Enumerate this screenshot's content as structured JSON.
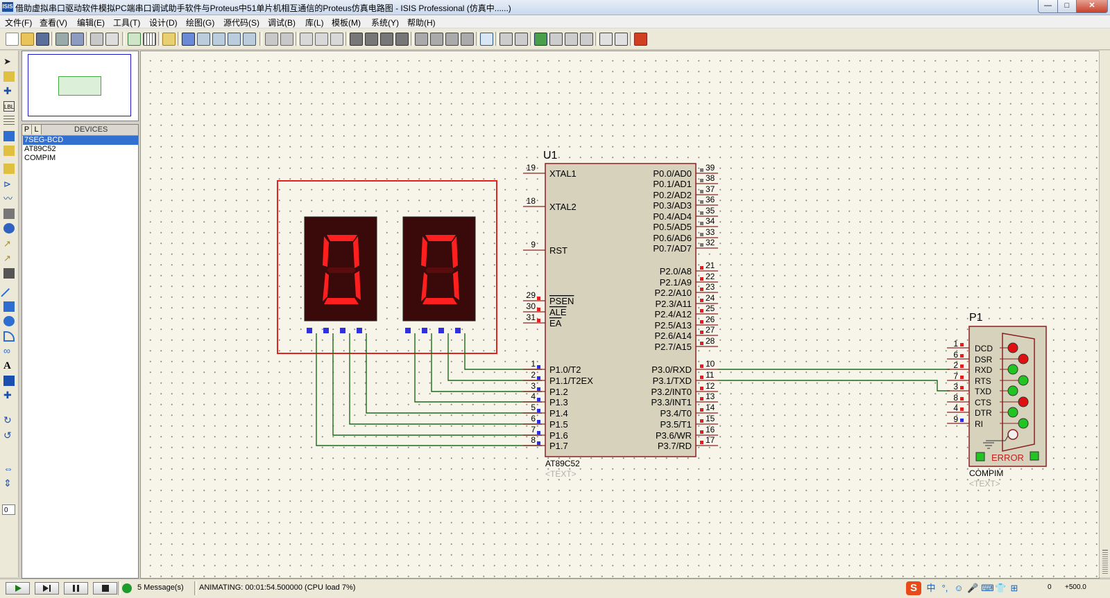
{
  "window": {
    "title": "借助虚拟串口驱动软件模拟PC端串口调试助手软件与Proteus中51单片机相互通信的Proteus仿真电路图 - ISIS Professional (仿真中......)",
    "app_icon": "ISIS",
    "min_glyph": "—",
    "max_glyph": "□",
    "close_glyph": "✕"
  },
  "menu": [
    "文件(F)",
    "查看(V)",
    "编辑(E)",
    "工具(T)",
    "设计(D)",
    "绘图(G)",
    "源代码(S)",
    "调试(B)",
    "库(L)",
    "模板(M)",
    "系统(Y)",
    "帮助(H)"
  ],
  "devices": {
    "tab_p": "P",
    "tab_l": "L",
    "header": "DEVICES",
    "items": [
      "7SEG-BCD",
      "AT89C52",
      "COMPIM"
    ],
    "selected_index": 0
  },
  "zoom_field": "0",
  "schematic": {
    "digits": [
      "0",
      "0"
    ],
    "mcu": {
      "ref": "U1",
      "part": "AT89C52",
      "text": "<TEXT>",
      "left_pins": [
        {
          "num": "19",
          "name": "XTAL1"
        },
        {
          "num": "18",
          "name": "XTAL2"
        },
        {
          "num": "9",
          "name": "RST"
        },
        {
          "num": "29",
          "name": "PSEN"
        },
        {
          "num": "30",
          "name": "ALE"
        },
        {
          "num": "31",
          "name": "EA"
        },
        {
          "num": "1",
          "name": "P1.0/T2"
        },
        {
          "num": "2",
          "name": "P1.1/T2EX"
        },
        {
          "num": "3",
          "name": "P1.2"
        },
        {
          "num": "4",
          "name": "P1.3"
        },
        {
          "num": "5",
          "name": "P1.4"
        },
        {
          "num": "6",
          "name": "P1.5"
        },
        {
          "num": "7",
          "name": "P1.6"
        },
        {
          "num": "8",
          "name": "P1.7"
        }
      ],
      "right_pins": [
        {
          "num": "39",
          "name": "P0.0/AD0"
        },
        {
          "num": "38",
          "name": "P0.1/AD1"
        },
        {
          "num": "37",
          "name": "P0.2/AD2"
        },
        {
          "num": "36",
          "name": "P0.3/AD3"
        },
        {
          "num": "35",
          "name": "P0.4/AD4"
        },
        {
          "num": "34",
          "name": "P0.5/AD5"
        },
        {
          "num": "33",
          "name": "P0.6/AD6"
        },
        {
          "num": "32",
          "name": "P0.7/AD7"
        },
        {
          "num": "21",
          "name": "P2.0/A8"
        },
        {
          "num": "22",
          "name": "P2.1/A9"
        },
        {
          "num": "23",
          "name": "P2.2/A10"
        },
        {
          "num": "24",
          "name": "P2.3/A11"
        },
        {
          "num": "25",
          "name": "P2.4/A12"
        },
        {
          "num": "26",
          "name": "P2.5/A13"
        },
        {
          "num": "27",
          "name": "P2.6/A14"
        },
        {
          "num": "28",
          "name": "P2.7/A15"
        },
        {
          "num": "10",
          "name": "P3.0/RXD"
        },
        {
          "num": "11",
          "name": "P3.1/TXD"
        },
        {
          "num": "12",
          "name": "P3.2/INT0"
        },
        {
          "num": "13",
          "name": "P3.3/INT1"
        },
        {
          "num": "14",
          "name": "P3.4/T0"
        },
        {
          "num": "15",
          "name": "P3.5/T1"
        },
        {
          "num": "16",
          "name": "P3.6/WR"
        },
        {
          "num": "17",
          "name": "P3.7/RD"
        }
      ]
    },
    "compim": {
      "ref": "P1",
      "part": "COMPIM",
      "text": "<TEXT>",
      "pins": [
        {
          "num": "1",
          "name": "DCD",
          "led": "#e01010"
        },
        {
          "num": "6",
          "name": "DSR",
          "led": "#e01010"
        },
        {
          "num": "2",
          "name": "RXD",
          "led": "#22c422"
        },
        {
          "num": "7",
          "name": "RTS",
          "led": "#22c422"
        },
        {
          "num": "3",
          "name": "TXD",
          "led": "#22c422"
        },
        {
          "num": "8",
          "name": "CTS",
          "led": "#e01010"
        },
        {
          "num": "4",
          "name": "DTR",
          "led": "#22c422"
        },
        {
          "num": "9",
          "name": "RI",
          "led": "#22c422"
        }
      ],
      "error_label": "ERROR"
    }
  },
  "status": {
    "messages": "5 Message(s)",
    "animating": "ANIMATING: 00:01:54.500000 (CPU load 7%)",
    "coord_x": "0",
    "coord_y": "+500.0"
  },
  "ime": [
    "中",
    "°,",
    "☺",
    "🎤",
    "⌨",
    "👕",
    "⊞"
  ]
}
